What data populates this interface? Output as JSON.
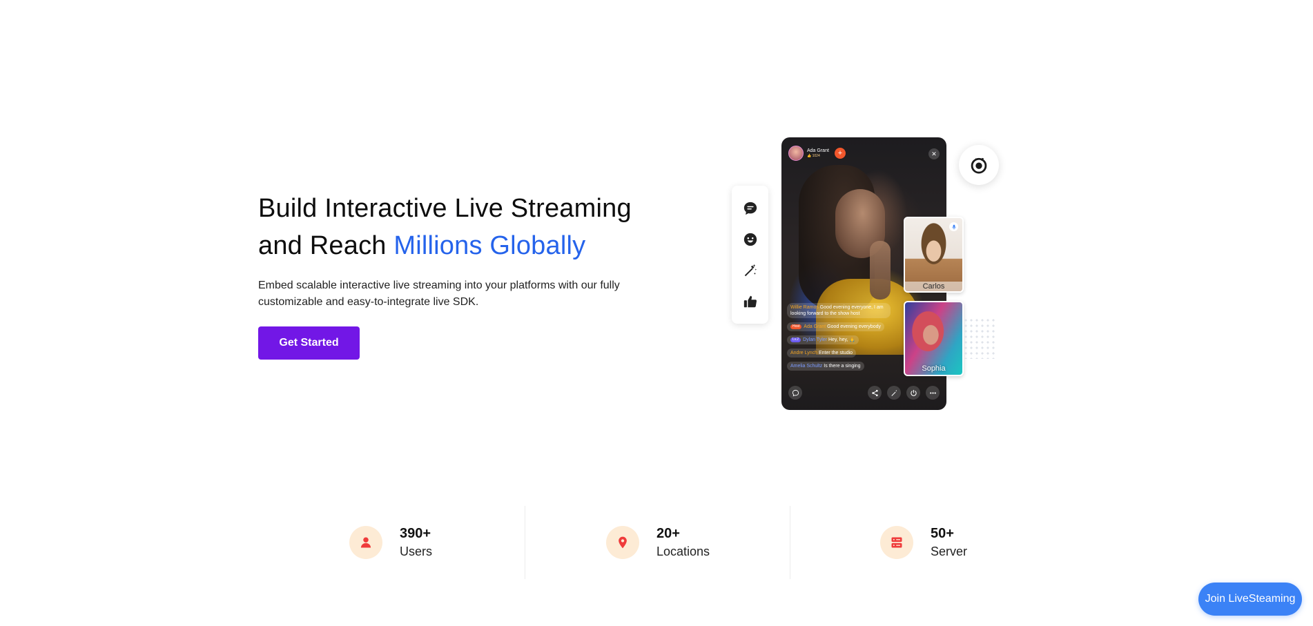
{
  "hero": {
    "title_line1": "Build Interactive Live Streaming",
    "title_line2_prefix": "and Reach ",
    "title_line2_accent": "Millions Globally",
    "description": "Embed scalable interactive live streaming into your platforms with our fully customizable and easy-to-integrate live SDK.",
    "cta_label": "Get Started"
  },
  "colors": {
    "accent_blue": "#2563eb",
    "cta_purple": "#7217e6",
    "stat_icon_bg": "#fdebd5",
    "stat_icon": "#ef3b3b",
    "join_button": "#3b82f6"
  },
  "rail": {
    "icons": [
      "chat-bubble-icon",
      "emoji-icon",
      "magic-wand-icon",
      "thumbs-up-icon"
    ]
  },
  "stream": {
    "host_name": "Ada Grant",
    "host_meta": "👍 1024",
    "follow_symbol": "+",
    "close_symbol": "✕",
    "chat": [
      {
        "user": "Willie Ramos",
        "text": "Good evening everyone, I am looking forward to the  show host",
        "badge": ""
      },
      {
        "user": "Ada Grant",
        "text": "Good evening everybody",
        "badge": "Host"
      },
      {
        "user": "Dylan Tyler",
        "text": "Hey, hey, 🙏",
        "badge": "Lv.2"
      },
      {
        "user": "Andre Lynch",
        "text": "Enter the studio",
        "badge": ""
      },
      {
        "user": "Amelia Schultz",
        "text": "Is there a singing",
        "badge": ""
      }
    ],
    "bottom_icons": [
      "chat-icon",
      "share-icon",
      "magic-icon",
      "power-icon",
      "more-icon"
    ]
  },
  "guests": [
    {
      "name": "Carlos"
    },
    {
      "name": "Sophia"
    }
  ],
  "stats": [
    {
      "value": "390+",
      "label": "Users",
      "icon": "user-icon"
    },
    {
      "value": "20+",
      "label": "Locations",
      "icon": "location-pin-icon"
    },
    {
      "value": "50+",
      "label": "Server",
      "icon": "server-icon"
    }
  ],
  "join_button": "Join LiveSteaming"
}
